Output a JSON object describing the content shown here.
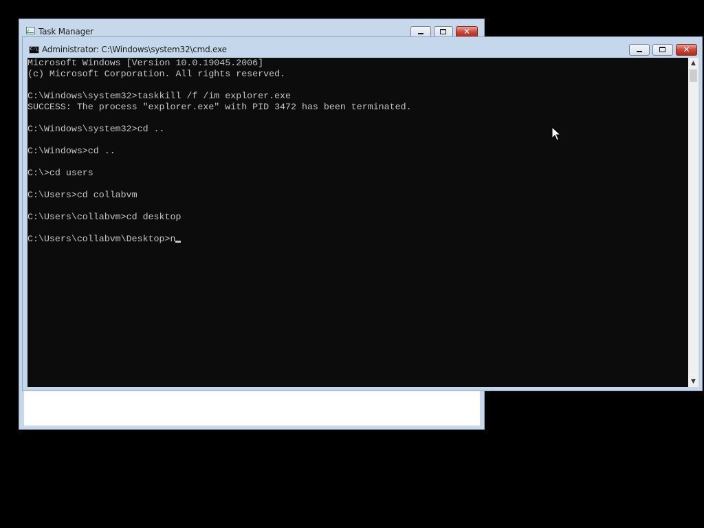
{
  "task_manager": {
    "title": "Task Manager"
  },
  "cmd": {
    "title": "Administrator: C:\\Windows\\system32\\cmd.exe",
    "icon_label": "C:\\",
    "lines": [
      "Microsoft Windows [Version 10.0.19045.2006]",
      "(c) Microsoft Corporation. All rights reserved.",
      "",
      "C:\\Windows\\system32>taskkill /f /im explorer.exe",
      "SUCCESS: The process \"explorer.exe\" with PID 3472 has been terminated.",
      "",
      "C:\\Windows\\system32>cd ..",
      "",
      "C:\\Windows>cd ..",
      "",
      "C:\\>cd users",
      "",
      "C:\\Users>cd collabvm",
      "",
      "C:\\Users\\collabvm>cd desktop",
      "",
      "C:\\Users\\collabvm\\Desktop>n"
    ]
  },
  "icons": {
    "task_manager_icon": "task-manager-icon",
    "cmd_icon": "cmd-icon",
    "minimize": "minimize-icon",
    "maximize": "maximize-icon",
    "close": "close-icon",
    "scroll_up": "chevron-up-icon",
    "scroll_down": "chevron-down-icon",
    "pointer": "mouse-pointer-icon"
  },
  "colors": {
    "console_bg": "#0c0c0c",
    "console_fg": "#c6c6c6",
    "title_bar": "#c5d7ea",
    "close_button": "#c8483a",
    "desktop": "#000000"
  }
}
